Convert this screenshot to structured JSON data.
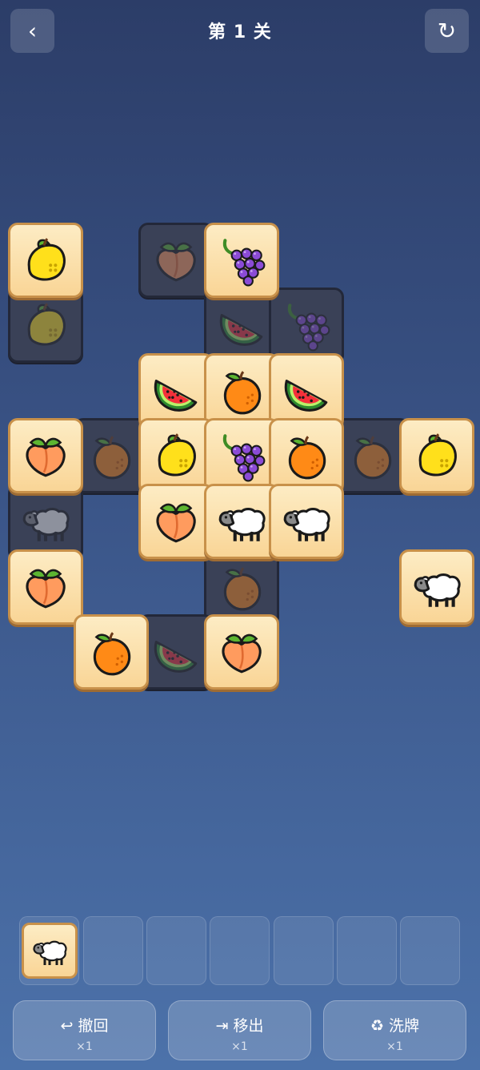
{
  "header": {
    "back_icon": "‹",
    "title": "第 1 关",
    "reset_icon": "↻"
  },
  "tiles": [
    {
      "type": "lemon",
      "free": true
    },
    {
      "type": "lemon",
      "free": false
    },
    {
      "type": "peach",
      "free": false
    },
    {
      "type": "grapes",
      "free": true
    },
    {
      "type": "watermelon",
      "free": false
    },
    {
      "type": "grapes",
      "free": false
    },
    {
      "type": "watermelon",
      "free": true
    },
    {
      "type": "orange",
      "free": true
    },
    {
      "type": "watermelon",
      "free": true
    },
    {
      "type": "peach",
      "free": true
    },
    {
      "type": "orange",
      "free": false
    },
    {
      "type": "lemon",
      "free": true
    },
    {
      "type": "grapes",
      "free": true
    },
    {
      "type": "orange",
      "free": true
    },
    {
      "type": "orange",
      "free": false
    },
    {
      "type": "lemon",
      "free": true
    },
    {
      "type": "sheep",
      "free": false
    },
    {
      "type": "peach",
      "free": true
    },
    {
      "type": "sheep",
      "free": true
    },
    {
      "type": "sheep",
      "free": true
    },
    {
      "type": "peach",
      "free": true
    },
    {
      "type": "orange",
      "free": false
    },
    {
      "type": "sheep",
      "free": true
    },
    {
      "type": "orange",
      "free": true
    },
    {
      "type": "watermelon",
      "free": false
    },
    {
      "type": "peach",
      "free": true
    }
  ],
  "tray": {
    "capacity": 7,
    "items": [
      "sheep"
    ]
  },
  "actions": {
    "undo": {
      "label": "↩ 撤回",
      "count": "×1"
    },
    "remove": {
      "label": "⇥ 移出",
      "count": "×1"
    },
    "shuffle": {
      "label": "♻ 洗牌",
      "count": "×1"
    }
  }
}
